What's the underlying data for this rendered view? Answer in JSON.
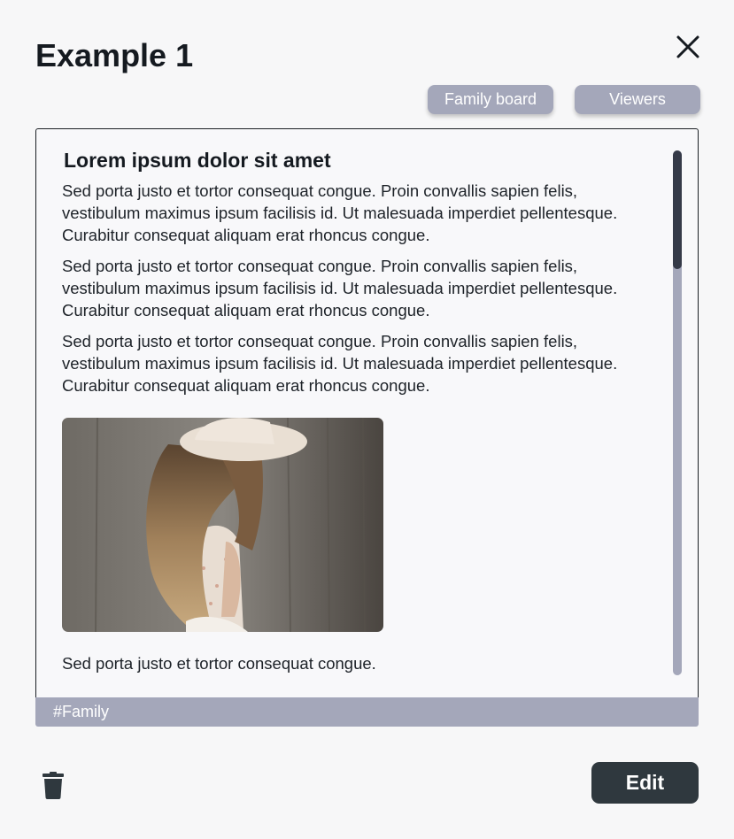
{
  "dialog": {
    "title": "Example 1"
  },
  "header_buttons": [
    {
      "label": "Family board"
    },
    {
      "label": "Viewers"
    }
  ],
  "post": {
    "heading": "Lorem ipsum dolor sit amet",
    "paragraphs": [
      "Sed porta justo et tortor consequat congue. Proin convallis sapien felis, vestibulum maximus ipsum facilisis id. Ut malesuada imperdiet pellentesque. Curabitur consequat aliquam erat rhoncus congue.",
      "Sed porta justo et tortor consequat congue. Proin convallis sapien felis, vestibulum maximus ipsum facilisis id. Ut malesuada imperdiet pellentesque. Curabitur consequat aliquam erat rhoncus congue.",
      "Sed porta justo et tortor consequat congue. Proin convallis sapien felis, vestibulum maximus ipsum facilisis id. Ut malesuada imperdiet pellentesque. Curabitur consequat aliquam erat rhoncus congue."
    ],
    "caption": "Sed porta justo et tortor consequat congue.",
    "tag": "#Family"
  },
  "actions": {
    "edit_label": "Edit"
  },
  "icons": {
    "close": "close-icon",
    "delete": "trash-icon"
  },
  "colors": {
    "accent_grey": "#a4a7ba",
    "edit_button": "#2f383e",
    "scroll_thumb": "#353a48",
    "background": "#f7f7f8"
  }
}
